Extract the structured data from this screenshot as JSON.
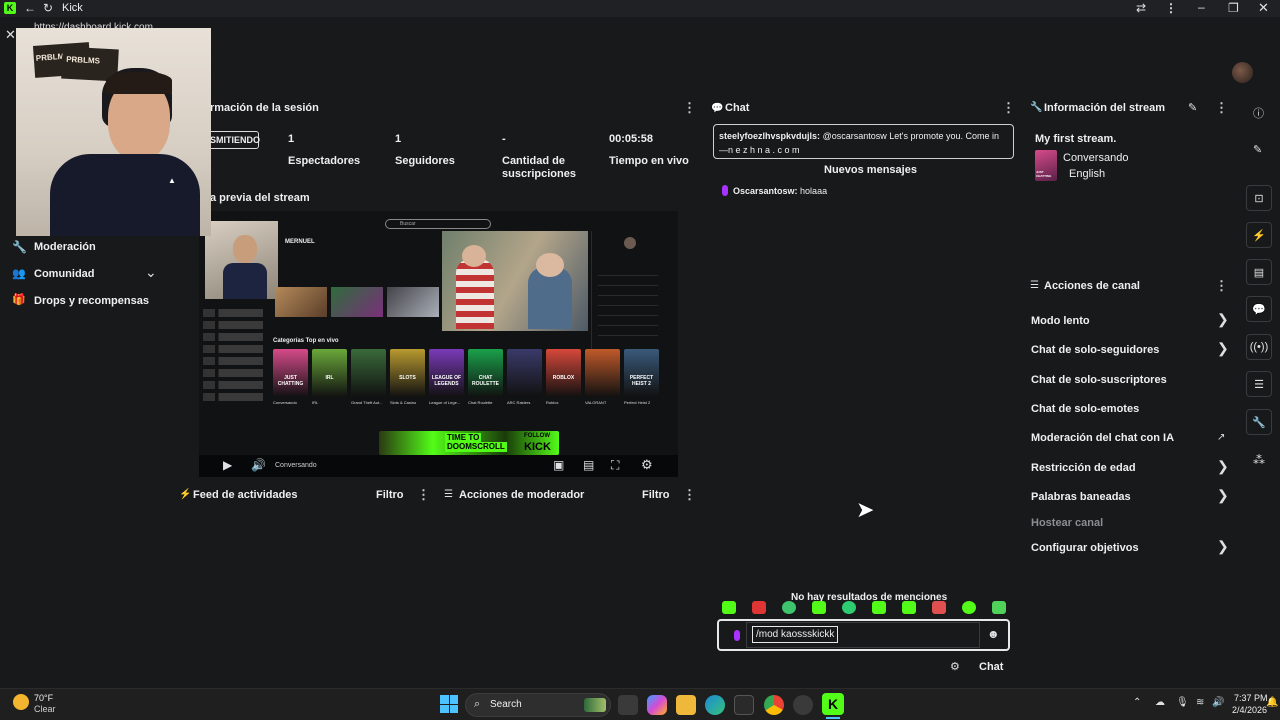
{
  "window": {
    "title": "Kick",
    "url": "https://dashboard.kick.com"
  },
  "session": {
    "title": "rmación de la sesión",
    "status_badge": "SMITIENDO",
    "stats": [
      {
        "value": "1",
        "label": "Espectadores"
      },
      {
        "value": "1",
        "label": "Seguidores"
      },
      {
        "value": "-",
        "label": "Cantidad de suscripciones"
      },
      {
        "value": "00:05:58",
        "label": "Tiempo en vivo"
      }
    ],
    "preview_title": "a previa del stream"
  },
  "sidebar": {
    "items": [
      {
        "label": "Moderación",
        "icon": "wrench-icon"
      },
      {
        "label": "Comunidad",
        "icon": "users-icon"
      },
      {
        "label": "Drops y recompensas",
        "icon": "gift-icon"
      }
    ]
  },
  "preview": {
    "search_placeholder": "Buscar",
    "streamer_name": "MERNUEL",
    "section_title": "Categorías Top en vivo",
    "banner_line1": "TIME TO",
    "banner_line2": "DOOMSCROLL",
    "banner_follow": "FOLLOW",
    "banner_kick": "KICK",
    "player_text": "Conversando",
    "categories": [
      "Conversando",
      "IRL",
      "Grand Theft Aut...",
      "Slots & Casino",
      "League of Lege...",
      "Chat Roulette",
      "ARC Raiders",
      "Roblox",
      "VALORANT",
      "Perfect Heist 2"
    ],
    "category_art_text": [
      "JUST CHATTING",
      "IRL",
      "",
      "SLOTS",
      "LEAGUE OF LEGENDS",
      "CHAT ROULETTE",
      "",
      "ROBLOX",
      "",
      "PERFECT HEIST 2"
    ]
  },
  "feeds": {
    "activity_title": "Feed de actividades",
    "activity_filter": "Filtro",
    "mod_title": "Acciones de moderador",
    "mod_filter": "Filtro"
  },
  "chat": {
    "title": "Chat",
    "pinned_user": "steelyfoezlhvspkvdujls:",
    "pinned_text": "@oscarsantosw Let's promote you. Come in",
    "pinned_text2": "—n e z h  n a . c o m",
    "new_messages": "Nuevos mensajes",
    "messages": [
      {
        "user": "Oscarsantosw:",
        "text": "holaaa"
      }
    ],
    "no_mentions": "No hay resultados de menciones",
    "input_value": "/mod kaossskickk",
    "send_label": "Chat"
  },
  "stream_info": {
    "title": "Información del stream",
    "stream_title": "My first stream.",
    "category": "Conversando",
    "language": "English",
    "category_art": "JUST CHATTING"
  },
  "channel_actions": {
    "title": "Acciones de canal",
    "items": [
      {
        "label": "Modo lento",
        "chevron": true
      },
      {
        "label": "Chat de solo-seguidores",
        "chevron": true
      },
      {
        "label": "Chat de solo-suscriptores",
        "chevron": false
      },
      {
        "label": "Chat de solo-emotes",
        "chevron": false
      },
      {
        "label": "Moderación del chat con IA",
        "chevron": false
      },
      {
        "label": "Restricción de edad",
        "chevron": true
      },
      {
        "label": "Palabras baneadas",
        "chevron": true
      },
      {
        "label": "Hostear canal",
        "chevron": false
      },
      {
        "label": "Configurar objetivos",
        "chevron": true
      }
    ]
  },
  "webcam": {
    "cap_text1": "PRBLMS",
    "cap_text2": "PRBLMS"
  },
  "taskbar": {
    "weather_temp": "70°F",
    "weather_desc": "Clear",
    "search_label": "Search",
    "time": "7:37 PM",
    "date": "2/4/2026"
  },
  "colors": {
    "accent": "#53fc18",
    "bg": "#18191b",
    "panel": "#202124"
  }
}
